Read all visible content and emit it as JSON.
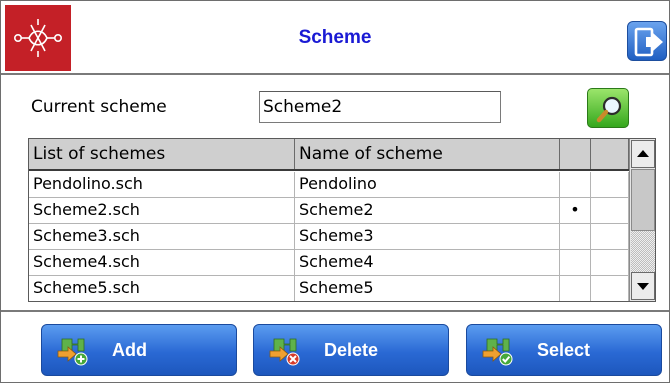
{
  "header": {
    "title": "Scheme",
    "logo_icon": "decorative-knot-icon",
    "exit_icon": "logout-icon"
  },
  "current_scheme": {
    "label": "Current scheme",
    "value": "Scheme2",
    "search_icon": "search-icon"
  },
  "table": {
    "columns": [
      "List of schemes",
      "Name of scheme",
      "",
      ""
    ],
    "rows": [
      {
        "file": "Pendolino.sch",
        "name": "Pendolino",
        "marker": ""
      },
      {
        "file": "Scheme2.sch",
        "name": "Scheme2",
        "marker": "•"
      },
      {
        "file": "Scheme3.sch",
        "name": "Scheme3",
        "marker": ""
      },
      {
        "file": "Scheme4.sch",
        "name": "Scheme4",
        "marker": ""
      },
      {
        "file": "Scheme5.sch",
        "name": "Scheme5",
        "marker": ""
      }
    ]
  },
  "footer": {
    "add_label": "Add",
    "delete_label": "Delete",
    "select_label": "Select"
  },
  "colors": {
    "brand_red": "#c42027",
    "title_blue": "#1a1ad4",
    "button_blue": "#2a69d4",
    "search_green": "#35a71d"
  }
}
